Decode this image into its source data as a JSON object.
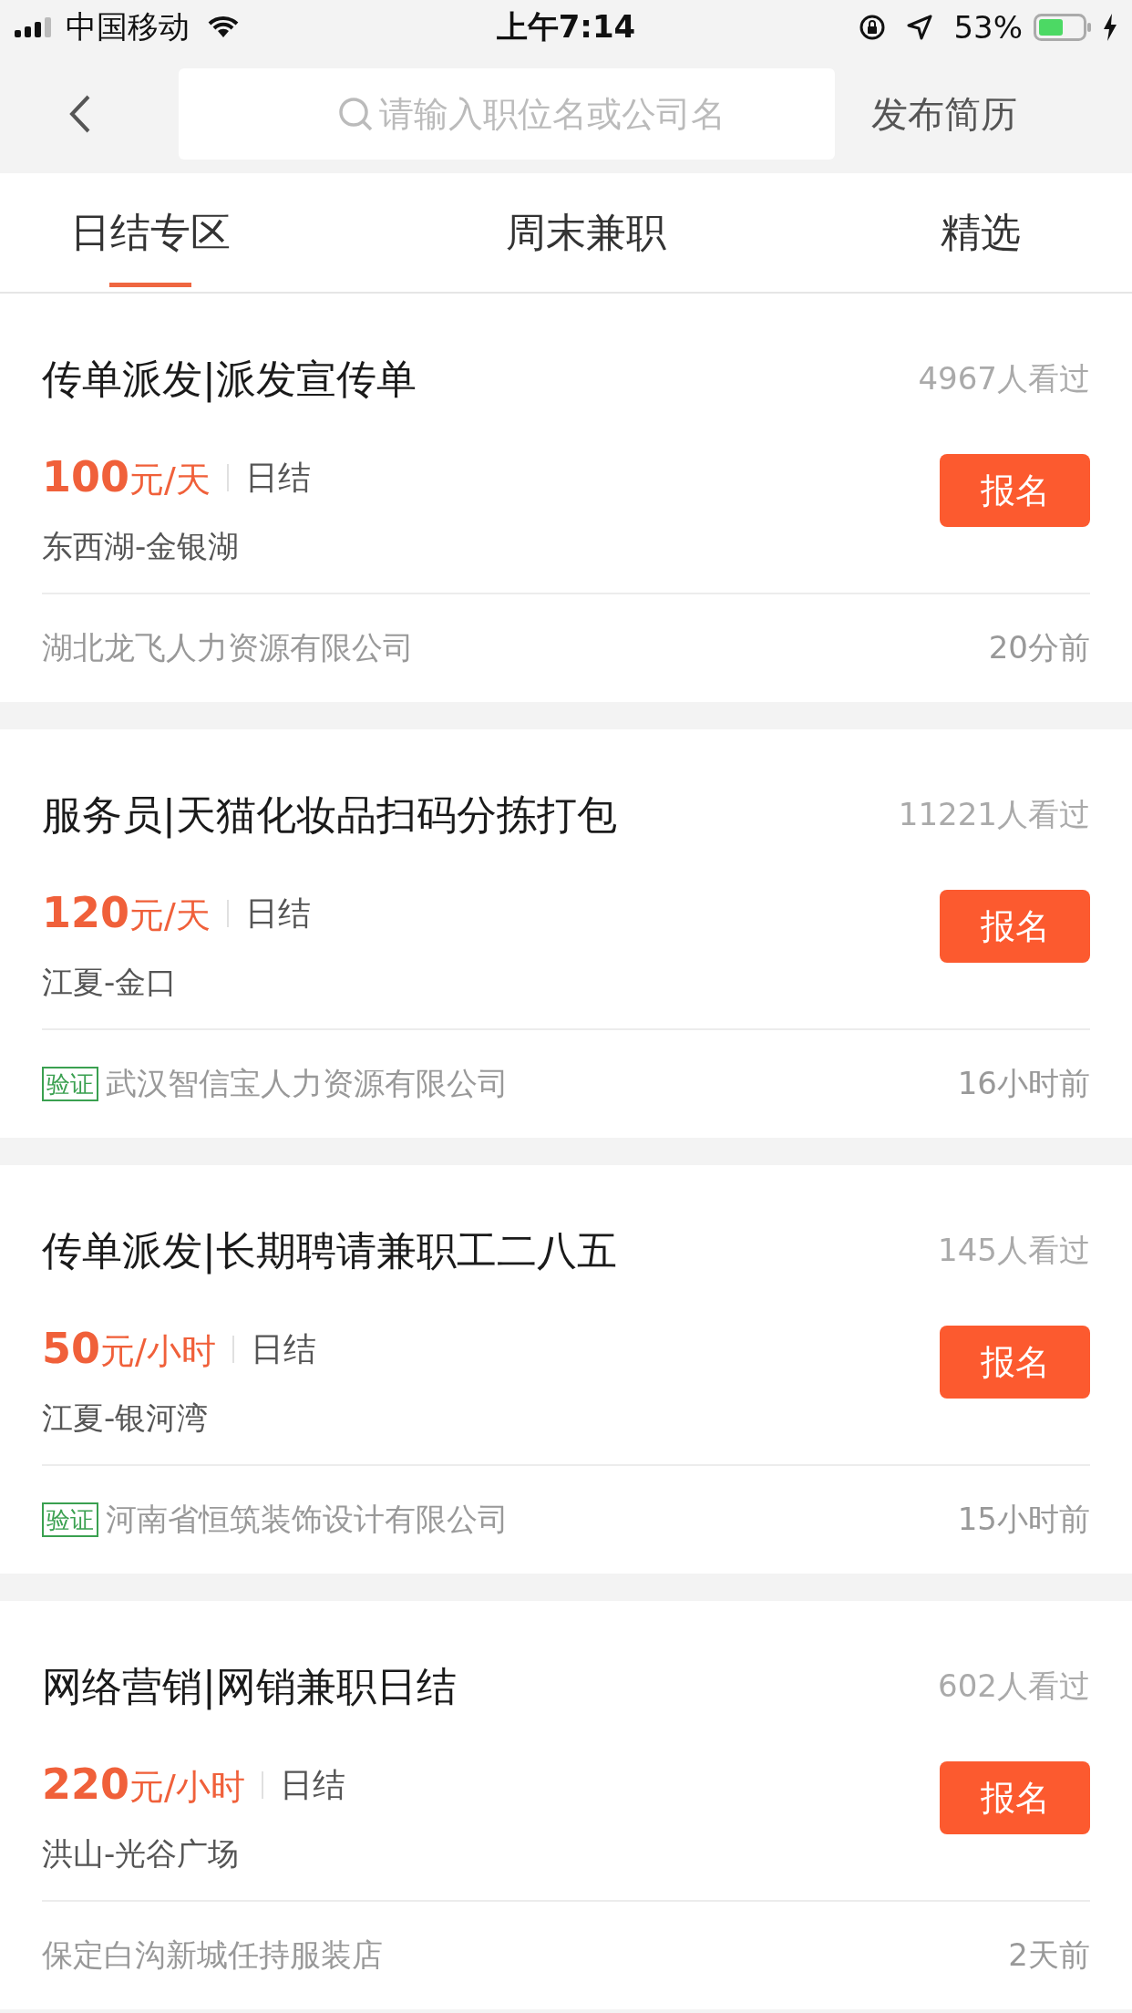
{
  "status_bar": {
    "carrier": "中国移动",
    "time": "上午7:14",
    "battery": "53%"
  },
  "nav": {
    "search": {
      "placeholder": "请输入职位名或公司名"
    },
    "action": "发布简历"
  },
  "tabs": [
    {
      "label": "日结专区",
      "selected": true
    },
    {
      "label": "周末兼职",
      "selected": false
    },
    {
      "label": "精选",
      "selected": false
    }
  ],
  "jobs": [
    {
      "title": "传单派发|派发宣传单",
      "views": "4967人看过",
      "pay": "**100**元/天",
      "settlement": "日结",
      "location": "东西湖-金银湖",
      "button": "报名",
      "verified": false,
      "company": "湖北龙飞人力资源有限公司",
      "posted": "20分前"
    },
    {
      "title": "服务员|天猫化妆品扫码分拣打包",
      "views": "11221人看过",
      "pay": "**120**元/天",
      "settlement": "日结",
      "location": "江夏-金口",
      "button": "报名",
      "verified": true,
      "badge": "验证",
      "company": "武汉智信宝人力资源有限公司",
      "posted": "16小时前"
    },
    {
      "title": "传单派发|长期聘请兼职工二八五",
      "views": "145人看过",
      "pay": "**50**元/小时",
      "settlement": "日结",
      "location": "江夏-银河湾",
      "button": "报名",
      "verified": true,
      "badge": "验证",
      "company": "河南省恒筑装饰设计有限公司",
      "posted": "15小时前"
    },
    {
      "title": "网络营销|网销兼职日结",
      "views": "602人看过",
      "pay": "**220**元/小时",
      "settlement": "日结",
      "location": "洪山-光谷广场",
      "button": "报名",
      "verified": false,
      "company": "保定白沟新城任持服装店",
      "posted": "2天前"
    }
  ]
}
